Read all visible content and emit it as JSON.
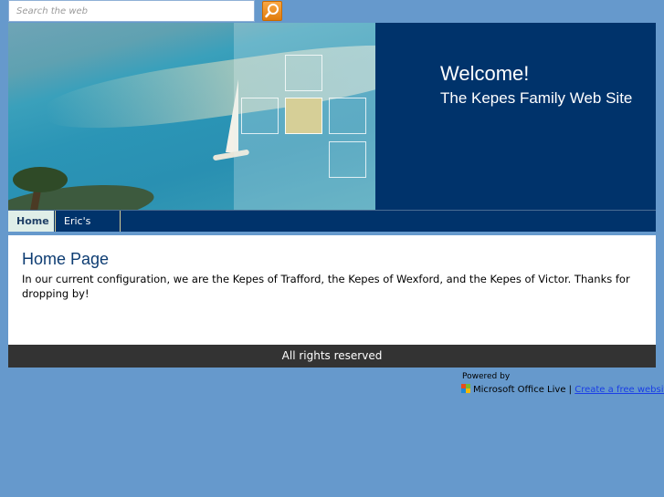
{
  "search": {
    "placeholder": "Search the web",
    "icon": "search-icon"
  },
  "header": {
    "welcome": "Welcome!",
    "site_title": "The Kepes Family Web Site"
  },
  "nav": {
    "items": [
      {
        "label": "Home",
        "active": true
      },
      {
        "label": "Eric's Blog",
        "active": false
      }
    ]
  },
  "main": {
    "title": "Home Page",
    "body": "In our current configuration, we are the Kepes of Trafford, the Kepes of Wexford, and the Kepes of Victor. Thanks for dropping by!"
  },
  "footer": {
    "text": "All rights reserved"
  },
  "powered": {
    "label": "Powered by",
    "product": "Microsoft Office Live",
    "separator": "|",
    "link": "Create a free website"
  },
  "colors": {
    "page_bg": "#6699cc",
    "header_bg": "#00336b",
    "accent": "#d6cf97",
    "footer_bg": "#333333",
    "title_color": "#0d3c72"
  }
}
